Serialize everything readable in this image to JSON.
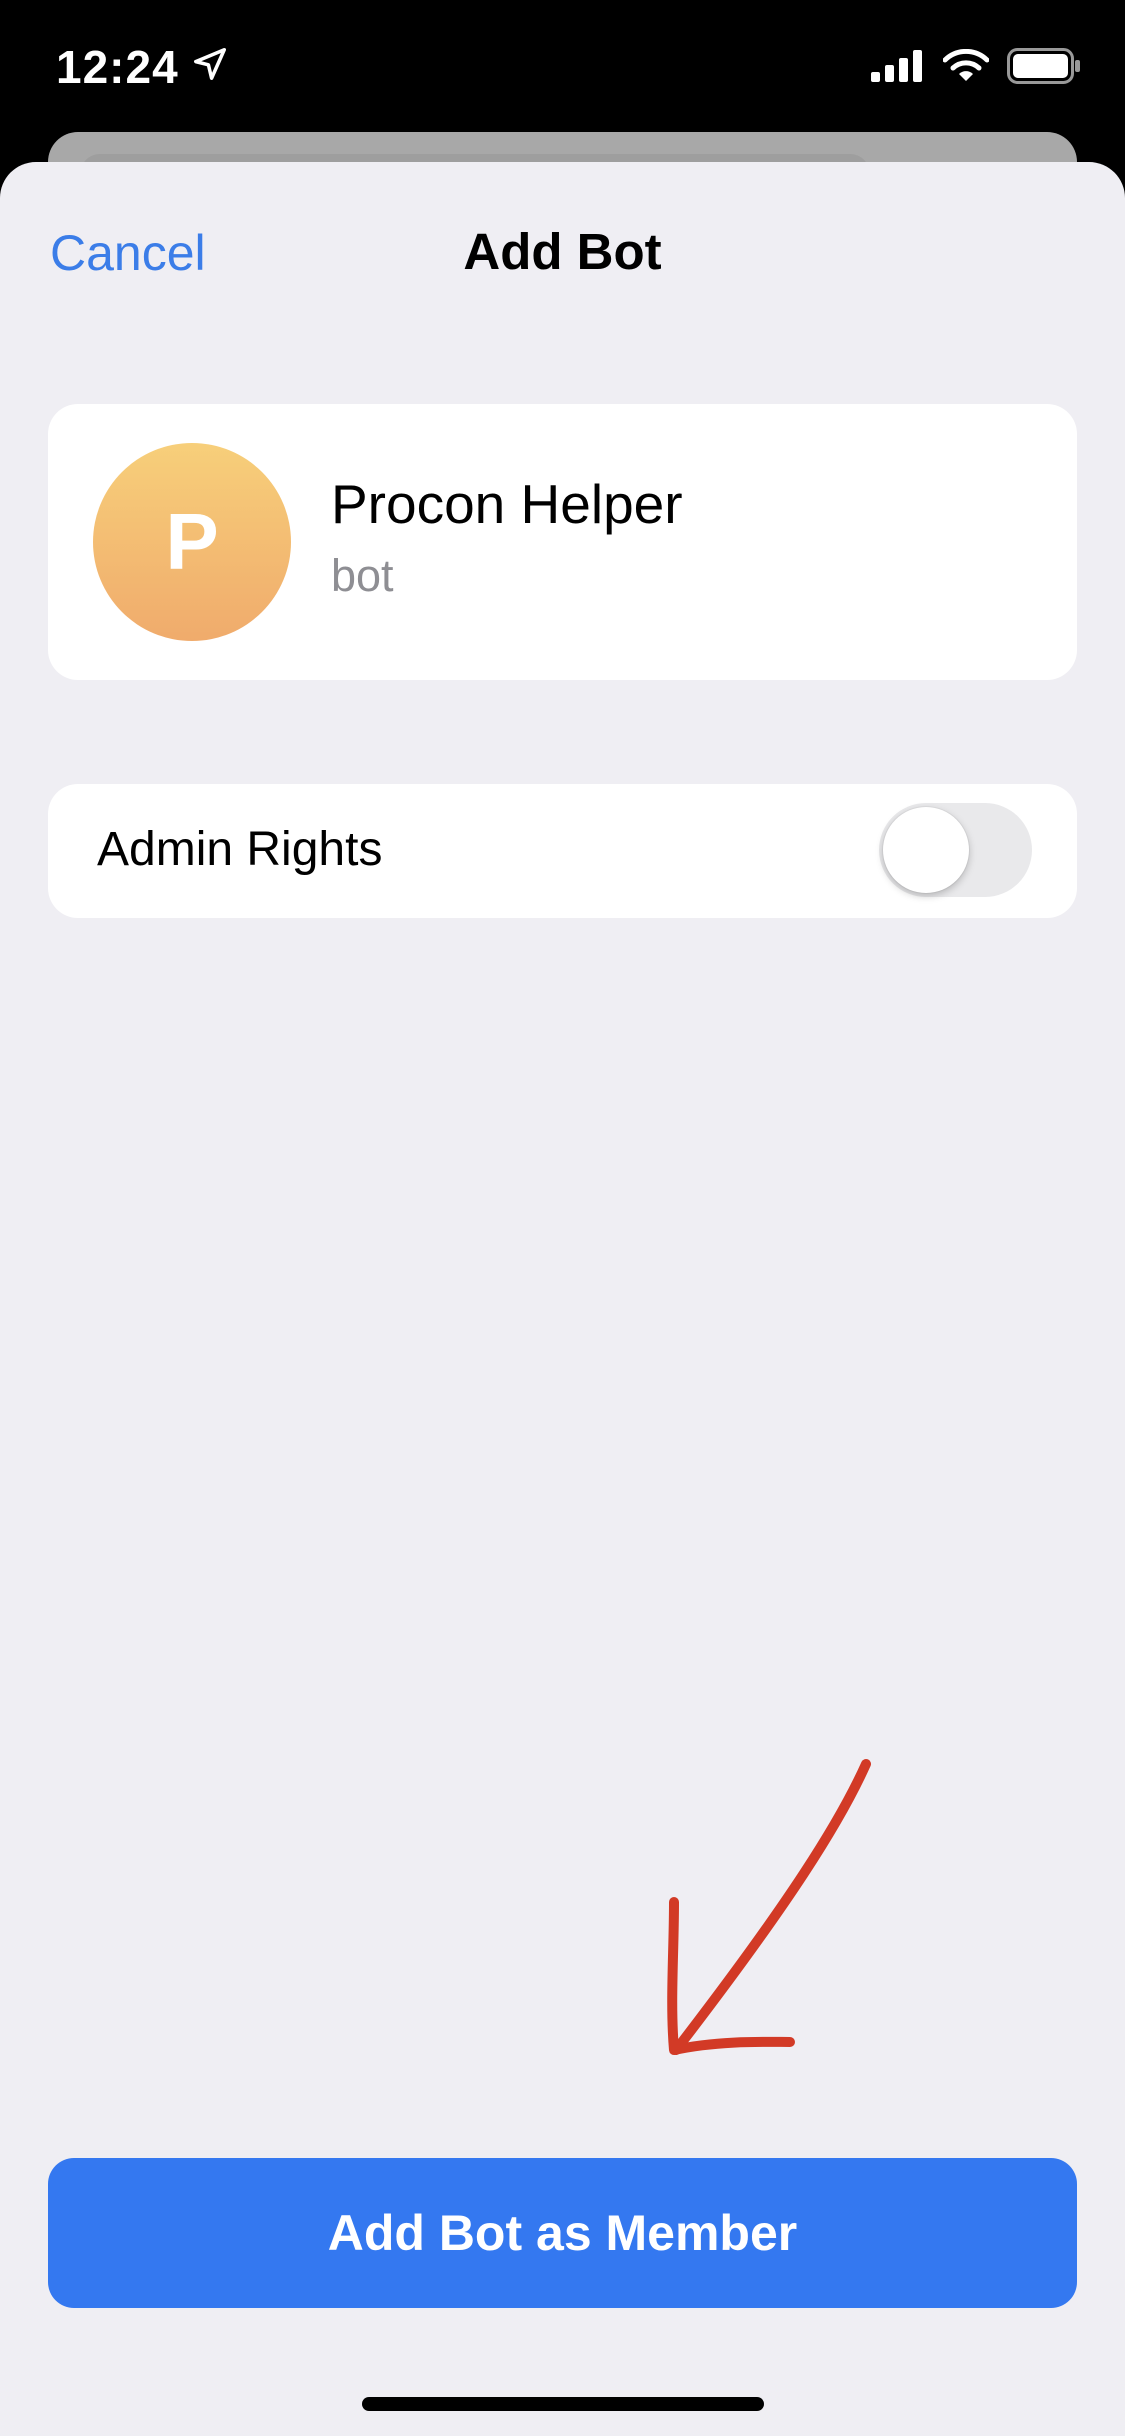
{
  "status_bar": {
    "time": "12:24",
    "icons": [
      "location-arrow-icon",
      "cellular-signal-icon",
      "wifi-icon",
      "battery-icon"
    ]
  },
  "nav": {
    "cancel_label": "Cancel",
    "title": "Add Bot"
  },
  "bot": {
    "initial": "P",
    "name": "Procon Helper",
    "subtitle": "bot"
  },
  "admin": {
    "label": "Admin Rights",
    "enabled": false
  },
  "primary_button": {
    "label": "Add Bot as Member"
  },
  "colors": {
    "accent": "#3478f0",
    "link": "#3b7de8",
    "annotation": "#d23a26",
    "avatar_top": "#f7cf7a",
    "avatar_bottom": "#f0ab6c"
  }
}
